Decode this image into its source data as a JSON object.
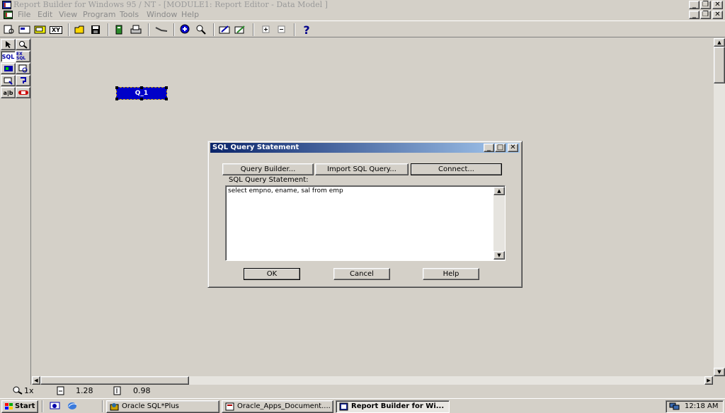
{
  "window": {
    "title": "Report Builder for Windows 95 / NT - [MODULE1: Report Editor - Data Model ]"
  },
  "menu": {
    "items": [
      "File",
      "Edit",
      "View",
      "Program",
      "Tools",
      "Window",
      "Help"
    ]
  },
  "toolbar": {
    "icons": [
      "new-report-icon",
      "new-data-model-icon",
      "new-layout-icon",
      "xy-icon",
      "open-icon",
      "save-icon",
      "run-icon",
      "print-icon",
      "link-icon",
      "zoom-in-icon",
      "zoom-out-icon",
      "edit-icon",
      "pencil-icon",
      "expand-icon",
      "collapse-icon",
      "help-icon"
    ],
    "xy_label": "XY",
    "help_label": "?"
  },
  "palette": {
    "sql_label": "SQL",
    "ext_label": "EX SQL",
    "text_label": "a|b"
  },
  "canvas": {
    "query_label": "Q_1"
  },
  "status": {
    "zoom": "1x",
    "x": "1.28",
    "y": "0.98"
  },
  "dialog": {
    "title": "SQL Query Statement",
    "query_builder_label": "Query Builder...",
    "import_label": "Import SQL Query...",
    "connect_label": "Connect...",
    "statement_label": "SQL Query Statement:",
    "sql_text": "select empno, ename, sal from emp",
    "ok_label": "OK",
    "cancel_label": "Cancel",
    "help_label": "Help"
  },
  "taskbar": {
    "start_label": "Start",
    "tasks": [
      {
        "label": "Oracle SQL*Plus"
      },
      {
        "label": "Oracle_Apps_Document...."
      },
      {
        "label": "Report Builder for Wi..."
      }
    ],
    "clock": "12:18 AM"
  }
}
